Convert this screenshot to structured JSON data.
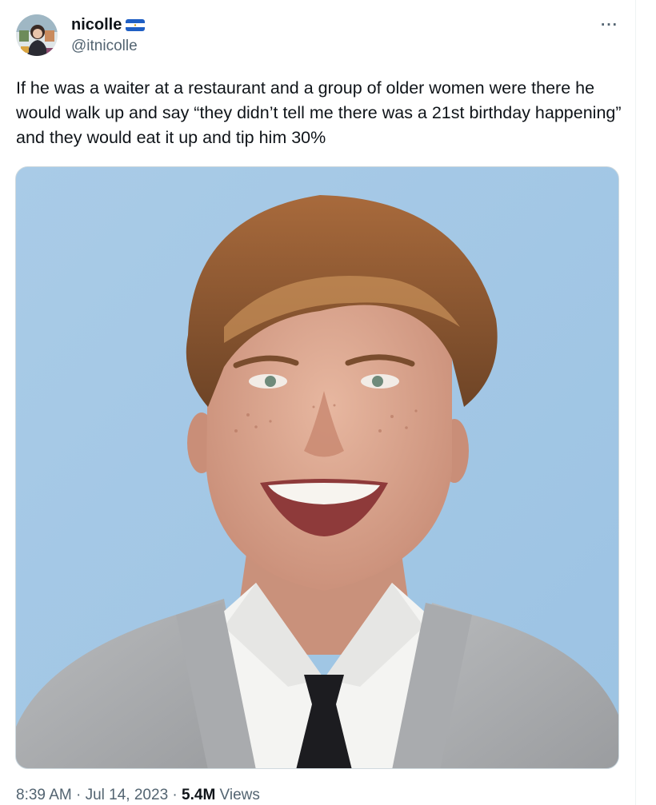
{
  "author": {
    "display_name": "nicolle",
    "handle": "@itnicolle",
    "badge_icon": "flag-icon"
  },
  "tweet": {
    "text": "If he was a waiter at a restaurant and a group of older women were there he would walk up and say “they didn’t tell me there was a 21st birthday happening” and they would eat it up and tip him 30%"
  },
  "more_menu_label": "···",
  "meta": {
    "time": "8:39 AM",
    "sep1": " · ",
    "date": "Jul 14, 2023",
    "sep2": " · ",
    "views_count": "5.4M",
    "views_label": " Views"
  },
  "colors": {
    "text_primary": "#0f1419",
    "text_secondary": "#536471",
    "photo_background": "#a8cbe6"
  }
}
